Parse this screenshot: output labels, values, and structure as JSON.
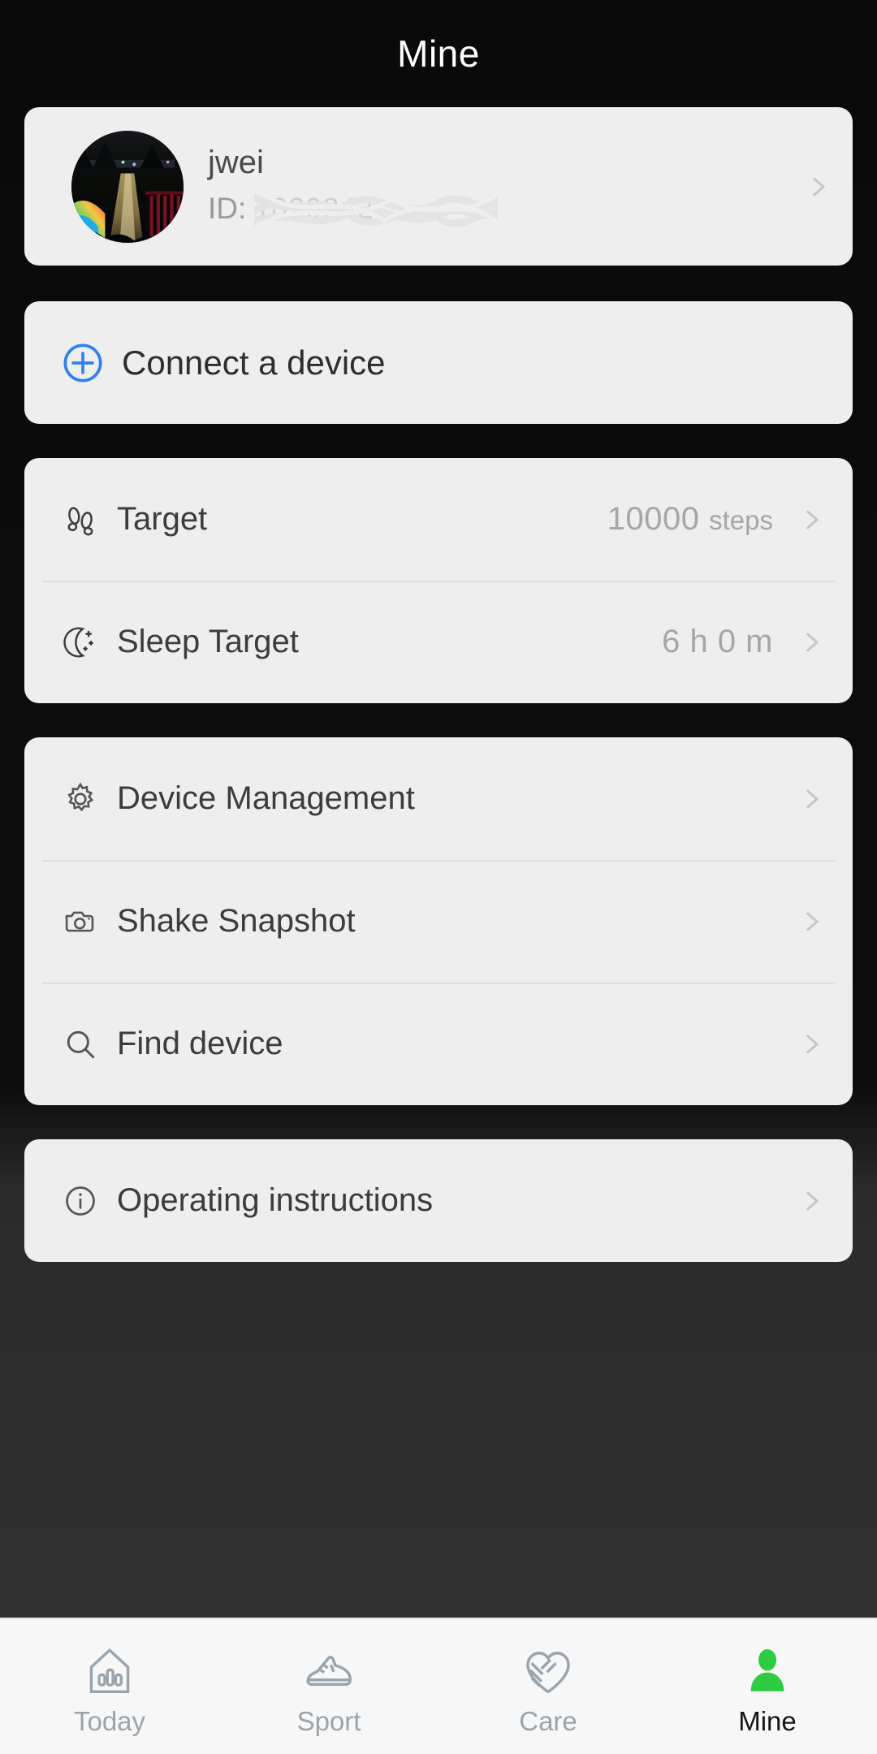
{
  "header": {
    "title": "Mine"
  },
  "colors": {
    "page_bg": "#0a0a0a",
    "card_bg": "#eeeeee",
    "accent_blue": "#2f80ed",
    "accent_green": "#2ecc40",
    "label_text": "#3c3c3c",
    "value_text": "#a6a6a6",
    "tab_inactive": "#9aa4ad",
    "tab_active": "#151515"
  },
  "profile": {
    "name": "jwei",
    "id_label": "ID:",
    "id_value": "1029342",
    "id_redacted": true,
    "avatar_icon": "avatar-photo",
    "chevron_icon": "chevron-right-icon"
  },
  "connect": {
    "label": "Connect a device",
    "icon": "plus-circle-icon"
  },
  "targets": [
    {
      "label": "Target",
      "icon": "footprints-icon",
      "value": "10000",
      "unit": "steps",
      "chevron_icon": "chevron-right-icon"
    },
    {
      "label": "Sleep Target",
      "icon": "moon-stars-icon",
      "value": "6 h 0 m",
      "unit": "",
      "chevron_icon": "chevron-right-icon"
    }
  ],
  "device_menu": [
    {
      "label": "Device Management",
      "icon": "gear-icon",
      "chevron_icon": "chevron-right-icon"
    },
    {
      "label": "Shake Snapshot",
      "icon": "camera-icon",
      "chevron_icon": "chevron-right-icon"
    },
    {
      "label": "Find device",
      "icon": "search-icon",
      "chevron_icon": "chevron-right-icon"
    }
  ],
  "help_menu": [
    {
      "label": "Operating instructions",
      "icon": "info-circle-icon",
      "chevron_icon": "chevron-right-icon"
    }
  ],
  "tabs": [
    {
      "label": "Today",
      "icon": "home-chart-icon",
      "active": false
    },
    {
      "label": "Sport",
      "icon": "sneaker-icon",
      "active": false
    },
    {
      "label": "Care",
      "icon": "heart-handshake-icon",
      "active": false
    },
    {
      "label": "Mine",
      "icon": "person-icon",
      "active": true
    }
  ]
}
